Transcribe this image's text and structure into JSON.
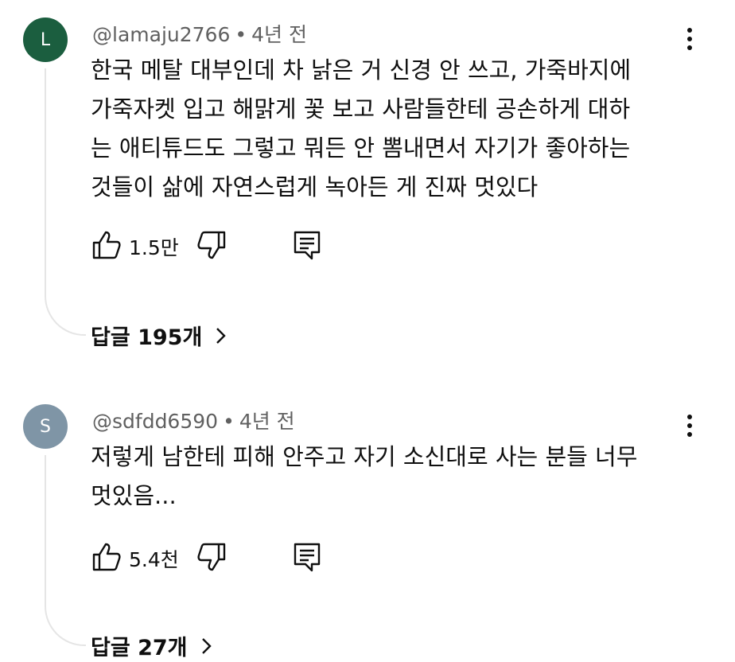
{
  "comments": [
    {
      "avatar_letter": "L",
      "avatar_color": "#1b5e3f",
      "handle": "@lamaju2766",
      "separator": "•",
      "time": "4년 전",
      "lines": [
        "한국 메탈 대부인데 차 낡은 거 신경 안 쓰고, 가죽바지에",
        "가죽자켓 입고 해맑게 꽃 보고 사람들한테 공손하게 대하",
        "는 애티튜드도 그렇고 뭐든 안 뽐내면서 자기가 좋아하는",
        "것들이 삶에 자연스럽게 녹아든 게 진짜 멋있다"
      ],
      "likes": "1.5만",
      "replies_label": "답글 195개",
      "icons": [
        "like-icon",
        "dislike-icon",
        "reply-icon",
        "more-vert-icon",
        "chevron-right-icon"
      ]
    },
    {
      "avatar_letter": "S",
      "avatar_color": "#7f95a6",
      "handle": "@sdfdd6590",
      "separator": "•",
      "time": "4년 전",
      "lines": [
        "저렇게 남한테 피해 안주고 자기 소신대로 사는 분들 너무",
        "멋있음..."
      ],
      "likes": "5.4천",
      "replies_label": "답글 27개",
      "icons": [
        "like-icon",
        "dislike-icon",
        "reply-icon",
        "more-vert-icon",
        "chevron-right-icon"
      ]
    }
  ]
}
